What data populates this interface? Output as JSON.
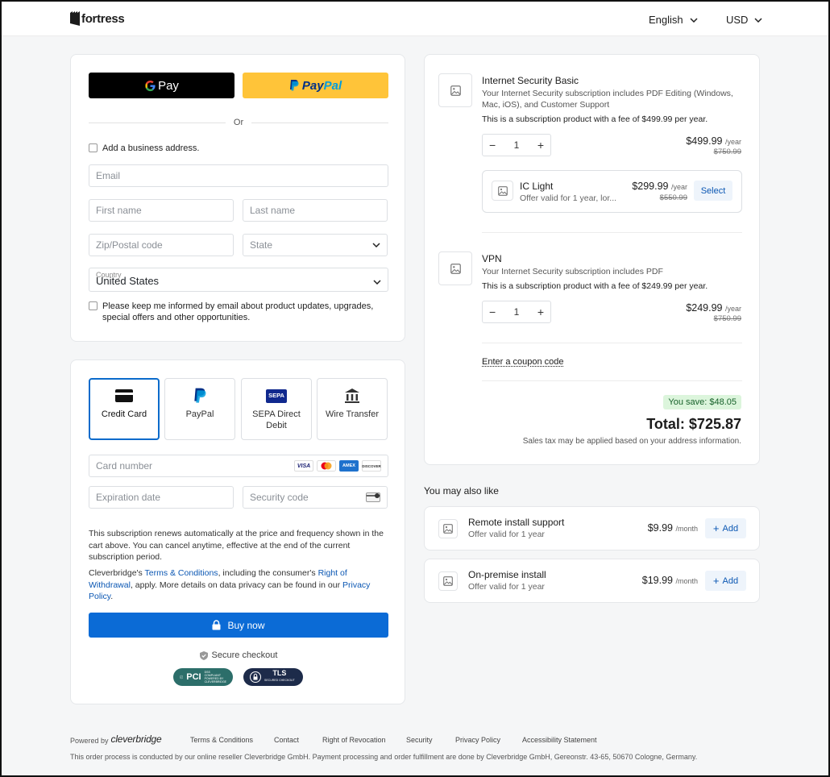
{
  "header": {
    "brand": "fortress",
    "language": "English",
    "currency": "USD"
  },
  "contact": {
    "gpay_label": "Pay",
    "paypal_pay": "Pay",
    "paypal_pal": "Pal",
    "or_label": "Or",
    "business_address_label": "Add a business address.",
    "email_placeholder": "Email",
    "first_name_placeholder": "First name",
    "last_name_placeholder": "Last name",
    "zip_placeholder": "Zip/Postal code",
    "state_placeholder": "State",
    "country_label": "Country",
    "country_value": "United States",
    "newsletter_line1": "Please keep me informed by email about product updates, upgrades,",
    "newsletter_line2": "special offers and other opportunities."
  },
  "payment": {
    "methods": [
      {
        "label": "Credit Card",
        "icon": "credit-card-icon",
        "selected": true
      },
      {
        "label": "PayPal",
        "icon": "paypal-icon",
        "selected": false
      },
      {
        "label": "SEPA Direct Debit",
        "icon": "sepa-icon",
        "selected": false
      },
      {
        "label": "Wire Transfer",
        "icon": "bank-icon",
        "selected": false
      }
    ],
    "sepa_icon_text": "SEPA",
    "card_number_placeholder": "Card number",
    "card_brands": [
      "VISA",
      "Mastercard",
      "AMEX",
      "DISCOVER"
    ],
    "expiration_placeholder": "Expiration date",
    "security_code_placeholder": "Security code",
    "renewal_text": "This subscription renews automatically at the price and frequency shown in the cart above. You can cancel anytime, effective at the end of the current subscription period.",
    "legal_prefix": "Cleverbridge's ",
    "terms_link": "Terms & Conditions",
    "legal_middle": ", including the consumer's ",
    "withdrawal_link": "Right of Withdrawal",
    "legal_middle2": ", apply. More details on data privacy can be found in our ",
    "privacy_link": "Privacy Policy",
    "legal_end": ".",
    "buy_label": "Buy now",
    "secure_label": "Secure checkout",
    "pci_label": "PCI",
    "pci_sub1": "DSS",
    "pci_sub2": "COMPLIANT",
    "pci_sub3": "POWERED BY CLEVERBRIDGE",
    "tls_label": "TLS",
    "tls_sub": "SECURED CHECKOUT"
  },
  "cart": {
    "items": [
      {
        "title": "Internet Security Basic",
        "desc_line1": "Your Internet Security subscription includes PDF Editing (Windows,",
        "desc_line2": "Mac, iOS),  and Customer Support",
        "note": "This is a subscription product with a fee of $499.99 per year.",
        "qty": "1",
        "price": "$499.99",
        "period": "/year",
        "old_price": "$750.99"
      },
      {
        "title": "VPN",
        "desc_line1": "Your Internet Security subscription includes PDF",
        "note": "This is a subscription product with a fee of $249.99 per year.",
        "qty": "1",
        "price": "$249.99",
        "period": "/year",
        "old_price": "$750.99"
      }
    ],
    "offer": {
      "title": "IC Light",
      "subtitle": "Offer valid for 1 year, lor...",
      "price": "$299.99",
      "period": "/year",
      "old_price": "$550.99",
      "select_label": "Select"
    },
    "coupon_label": "Enter a coupon code",
    "savings": "You save: $48.05",
    "total": "Total: $725.87",
    "tax_note": "Sales tax may be applied based on your address information."
  },
  "upsell": {
    "heading": "You may also like",
    "items": [
      {
        "title": "Remote install support",
        "subtitle": "Offer valid for 1 year",
        "price": "$9.99",
        "period": "/month",
        "add_label": "Add"
      },
      {
        "title": "On-premise install",
        "subtitle": "Offer valid for 1 year",
        "price": "$19.99",
        "period": "/month",
        "add_label": "Add"
      }
    ]
  },
  "footer": {
    "powered_by": "Powered by",
    "provider": "cleverbridge",
    "links": [
      "Terms & Conditions",
      "Contact",
      "Right of Revocation",
      "Security",
      "Privacy Policy",
      "Accessibility Statement"
    ],
    "disclaimer": "This order process is conducted by our online reseller Cleverbridge GmbH. Payment processing and order fulfillment are done by Cleverbridge GmbH, Gereonstr. 43-65, 50670 Cologne, Germany."
  },
  "colors": {
    "primary": "#0b6bd6",
    "paypal_yellow": "#ffc439",
    "savings_bg": "#dcf5dc",
    "link": "#0b57b3"
  }
}
